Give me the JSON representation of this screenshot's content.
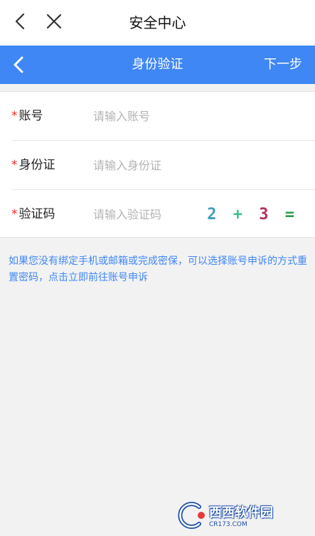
{
  "topbar": {
    "title": "安全中心",
    "back_icon": "chevron-left-icon",
    "close_icon": "close-icon"
  },
  "header": {
    "title": "身份验证",
    "next_label": "下一步",
    "back_icon": "chevron-left-icon",
    "bg_color": "#3f87f5"
  },
  "form": {
    "required_mark": "*",
    "account": {
      "label": "账号",
      "placeholder": "请输入账号",
      "value": ""
    },
    "id_card": {
      "label": "身份证",
      "placeholder": "请输入身份证",
      "value": ""
    },
    "captcha": {
      "label": "验证码",
      "placeholder": "请输入验证码",
      "value": "",
      "question": {
        "a": "2",
        "op": "+",
        "b": "3",
        "eq": "="
      }
    }
  },
  "help": {
    "text": "如果您没有绑定手机或邮箱或完成密保，可以选择账号申诉的方式重置密码，点击立即前往账号申诉"
  },
  "watermark": {
    "text": "西西软件园",
    "sub": "CR173.COM"
  }
}
